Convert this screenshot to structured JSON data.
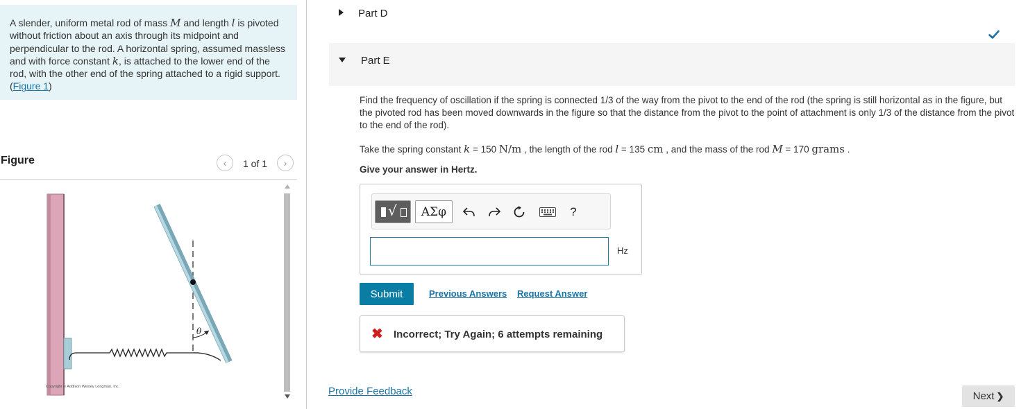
{
  "problem": {
    "t1": "A slender, uniform metal rod of mass ",
    "v_mass": "M",
    "t2": " and length ",
    "v_len": "l",
    "t3": " is pivoted without friction about an axis through its midpoint and perpendicular to the rod. A horizontal spring, assumed massless and with force constant ",
    "v_k": "k",
    "t4": ", is attached to the lower end of the rod, with the other end of the spring attached to a rigid support. (",
    "figure_link": "Figure 1",
    "t5": ")"
  },
  "figure": {
    "title": "Figure",
    "pager": "1 of 1",
    "angle_label": "θ",
    "copyright": "Copyright © Addison Wesley Longman, Inc."
  },
  "parts": {
    "d_label": "Part D",
    "d_status": "check-icon",
    "e_label": "Part E"
  },
  "question": {
    "text": "Find the frequency of oscillation if the spring is connected 1/3 of the way from the pivot to the end of the rod (the spring is still horizontal as in the figure, but the pivoted rod has been moved downwards in the figure so that the distance from the pivot to the point of attachment is only 1/3 of the distance from the pivot to the end of the rod).",
    "g1": "Take the spring constant ",
    "gk": "k",
    "g2": " = 150 ",
    "gk_unit": "N/m",
    "g3": " , the length of the rod ",
    "gl": "l",
    "g4": " = 135 ",
    "gl_unit": "cm",
    "g5": " , and the mass of the rod ",
    "gm": "M",
    "g6": " = 170 ",
    "gm_unit": "grams",
    "g7": " .",
    "instruction": "Give your answer in Hertz."
  },
  "toolbar": {
    "greek": "ΑΣφ",
    "help": "?"
  },
  "answer": {
    "value": "",
    "unit": "Hz"
  },
  "actions": {
    "submit": "Submit",
    "previous": "Previous Answers",
    "request": "Request Answer"
  },
  "feedback": {
    "mark": "✖",
    "message": "Incorrect; Try Again; 6 attempts remaining"
  },
  "footer": {
    "provide_feedback": "Provide Feedback",
    "next": "Next",
    "next_icon": "❯"
  },
  "colors": {
    "problem_bg": "#e6f4f7",
    "accent": "#0a7da5",
    "link": "#1a73a8",
    "error": "#d11f1f",
    "success": "#1a6fa0"
  }
}
